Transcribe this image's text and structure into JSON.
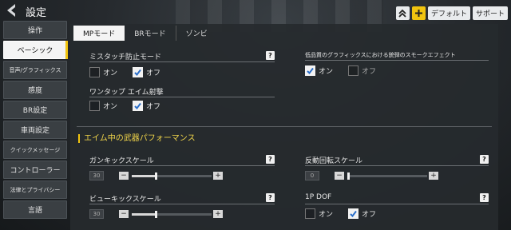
{
  "header": {
    "title": "設定",
    "default_label": "デフォルト",
    "support_label": "サポート",
    "accent": "#f1c40f"
  },
  "sidebar": {
    "items": [
      {
        "label": "操作"
      },
      {
        "label": "ベーシック",
        "active": true
      },
      {
        "label": "音声/グラフィックス"
      },
      {
        "label": "感度"
      },
      {
        "label": "BR設定"
      },
      {
        "label": "車両設定"
      },
      {
        "label": "クイックメッセージ"
      },
      {
        "label": "コントローラー"
      },
      {
        "label": "法律とプライバシー"
      },
      {
        "label": "言語"
      }
    ]
  },
  "tabs": [
    {
      "label": "MPモード",
      "active": true
    },
    {
      "label": "BRモード"
    },
    {
      "label": "ゾンビ"
    }
  ],
  "settings": {
    "misstouch": {
      "label": "ミスタッチ防止モード",
      "on_label": "オン",
      "off_label": "オフ",
      "selected": "off"
    },
    "onetap": {
      "label": "ワンタップ エイム射撃",
      "on_label": "オン",
      "off_label": "オフ",
      "selected": "off"
    },
    "smoke": {
      "label": "低品質のグラフィックスにおける銃弾のスモークエフェクト",
      "on_label": "オン",
      "off_label": "オフ",
      "selected": "on"
    },
    "section_title": "エイム中の武器パフォーマンス",
    "gun_kick": {
      "label": "ガンキックスケール",
      "value": "30",
      "level": 0.3
    },
    "recoil": {
      "label": "反動回転スケール",
      "value": "0",
      "level": 0.0
    },
    "view_kick": {
      "label": "ビューキックスケール",
      "value": "30",
      "level": 0.3
    },
    "dof": {
      "label": "1P DOF",
      "on_label": "オン",
      "off_label": "オフ",
      "selected": "off"
    }
  },
  "help_label": "?"
}
